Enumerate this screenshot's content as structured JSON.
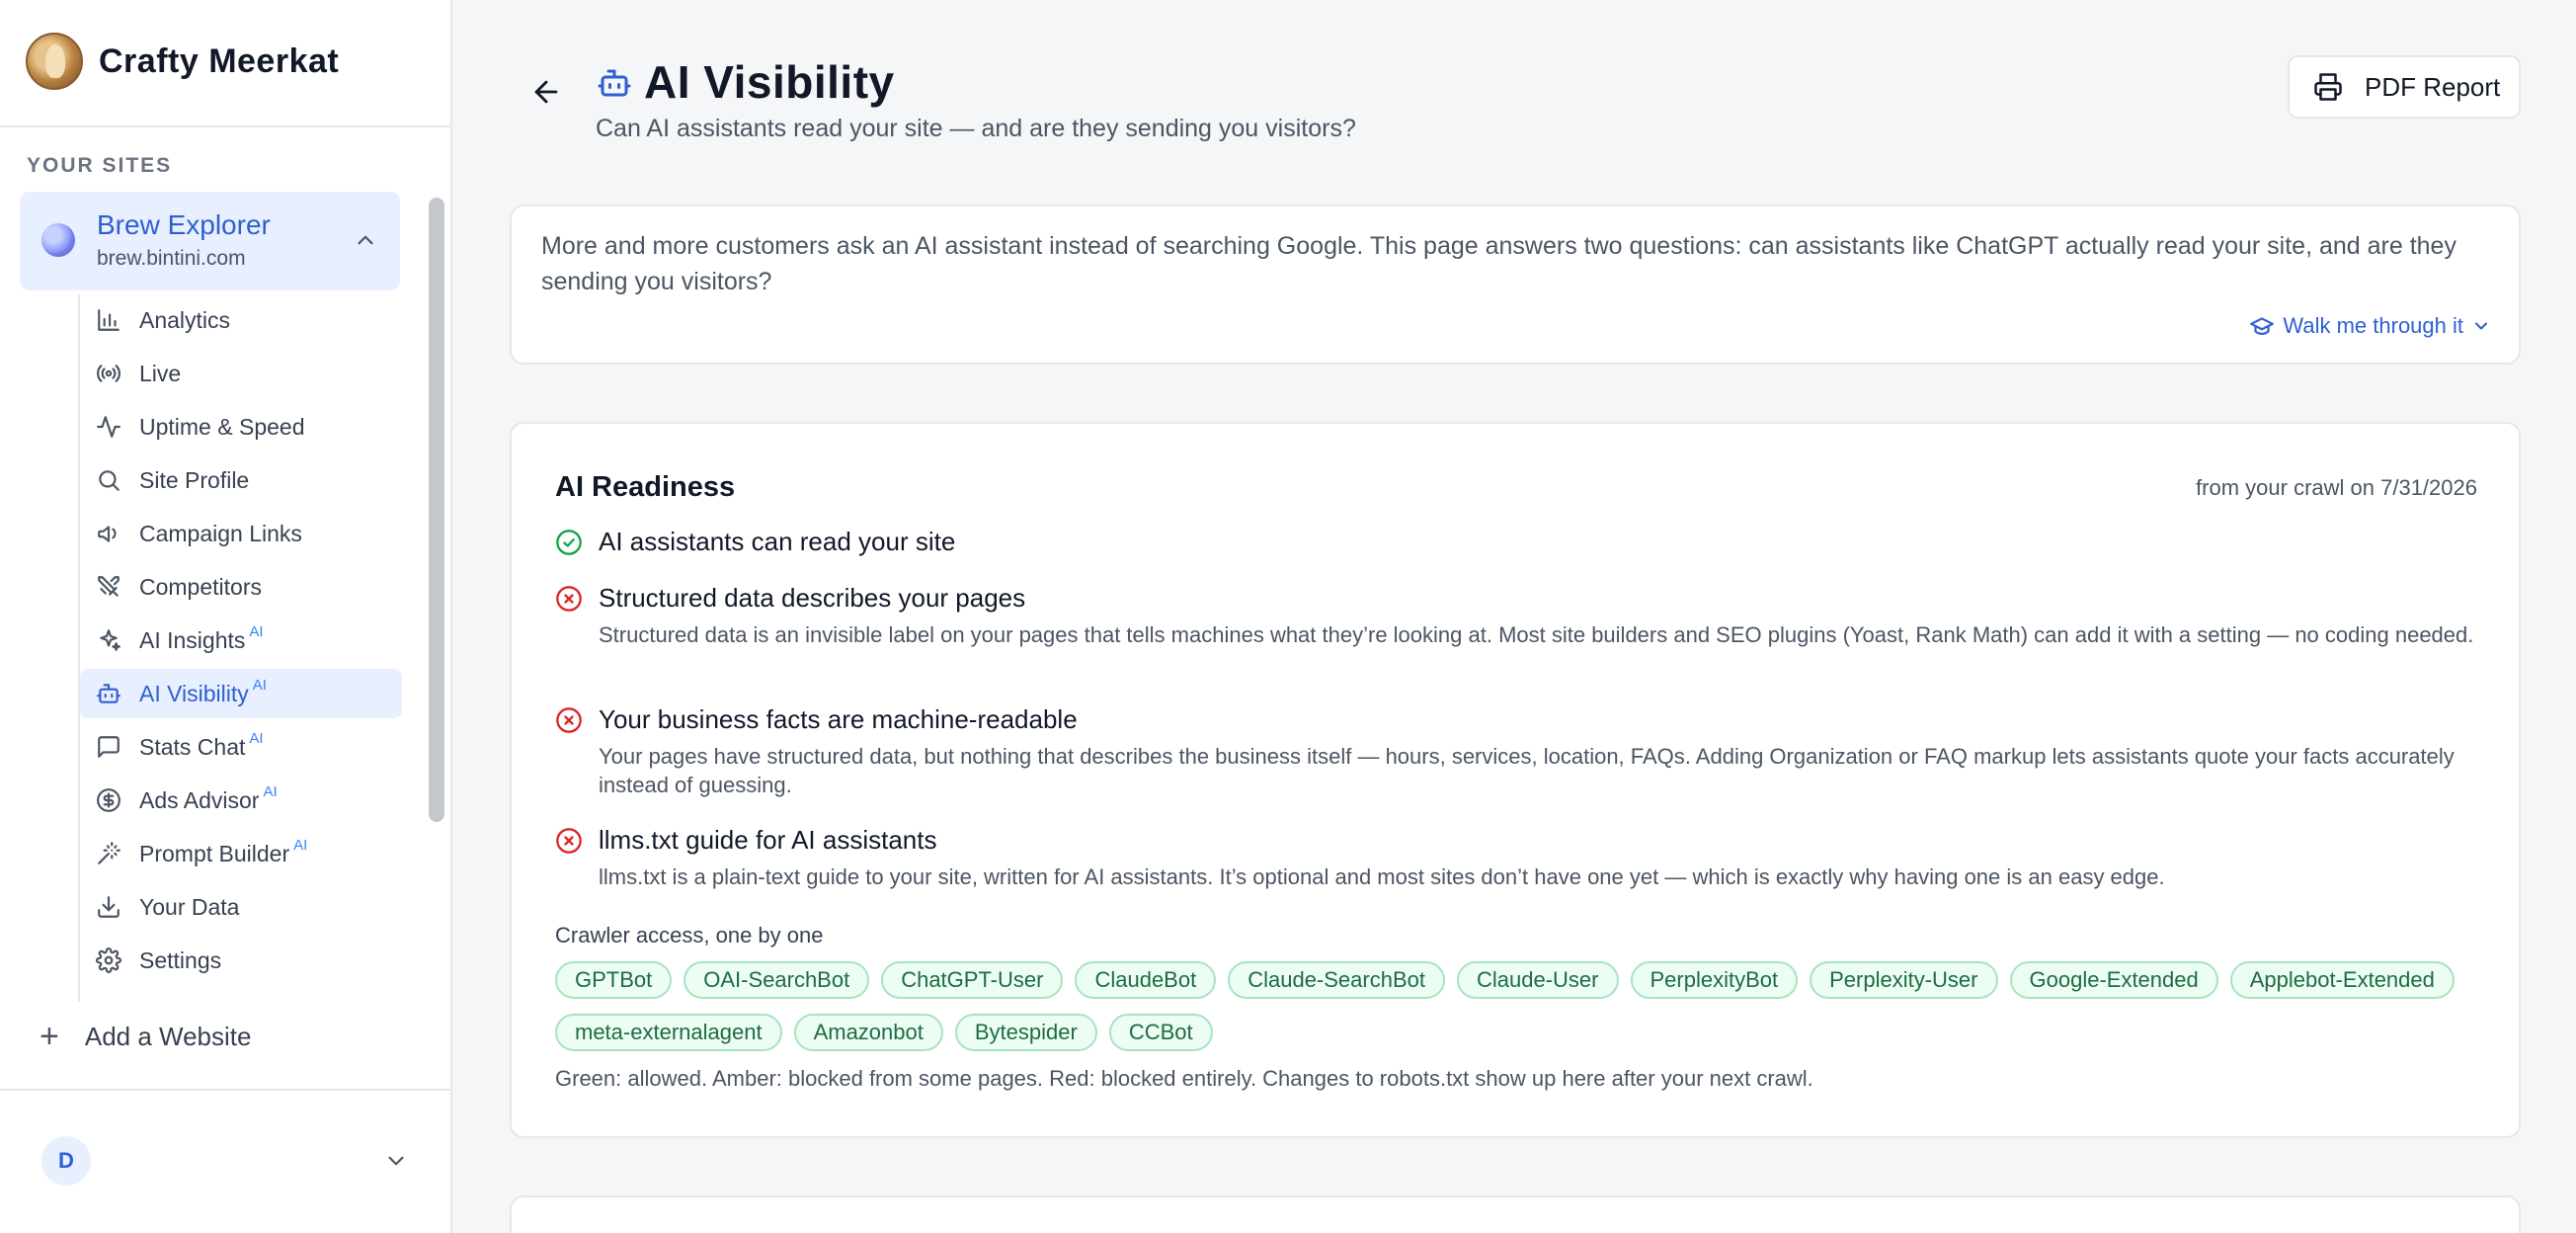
{
  "sidebar": {
    "brand": "Crafty Meerkat",
    "sites_label": "YOUR SITES",
    "site": {
      "name": "Brew Explorer",
      "url": "brew.bintini.com"
    },
    "nav": [
      {
        "label": "Analytics",
        "icon": "bar-chart-icon",
        "ai": ""
      },
      {
        "label": "Live",
        "icon": "broadcast-icon",
        "ai": ""
      },
      {
        "label": "Uptime & Speed",
        "icon": "activity-icon",
        "ai": ""
      },
      {
        "label": "Site Profile",
        "icon": "search-icon",
        "ai": ""
      },
      {
        "label": "Campaign Links",
        "icon": "megaphone-icon",
        "ai": ""
      },
      {
        "label": "Competitors",
        "icon": "swords-icon",
        "ai": ""
      },
      {
        "label": "AI Insights",
        "icon": "sparkles-icon",
        "ai": "AI"
      },
      {
        "label": "AI Visibility",
        "icon": "bot-icon",
        "ai": "AI"
      },
      {
        "label": "Stats Chat",
        "icon": "chat-icon",
        "ai": "AI"
      },
      {
        "label": "Ads Advisor",
        "icon": "dollar-icon",
        "ai": "AI"
      },
      {
        "label": "Prompt Builder",
        "icon": "wand-icon",
        "ai": "AI"
      },
      {
        "label": "Your Data",
        "icon": "download-icon",
        "ai": ""
      },
      {
        "label": "Settings",
        "icon": "gear-icon",
        "ai": ""
      }
    ],
    "active_nav": "AI Visibility",
    "add_site": "Add a Website",
    "user_initial": "D"
  },
  "header": {
    "title": "AI Visibility",
    "subtitle": "Can AI assistants read your site — and are they sending you visitors?",
    "pdf_label": "PDF Report"
  },
  "intro": {
    "text": "More and more customers ask an AI assistant instead of searching Google. This page answers two questions: can assistants like ChatGPT actually read your site, and are they sending you visitors?",
    "walk_label": "Walk me through it"
  },
  "readiness": {
    "title": "AI Readiness",
    "date": "from your crawl on 7/31/2026",
    "checks": [
      {
        "status": "pass",
        "title": "AI assistants can read your site",
        "desc": ""
      },
      {
        "status": "fail",
        "title": "Structured data describes your pages",
        "desc": "Structured data is an invisible label on your pages that tells machines what they’re looking at. Most site builders and SEO plugins (Yoast, Rank Math) can add it with a setting — no coding needed."
      },
      {
        "status": "fail",
        "title": "Your business facts are machine-readable",
        "desc": "Your pages have structured data, but nothing that describes the business itself — hours, services, location, FAQs. Adding Organization or FAQ markup lets assistants quote your facts accurately instead of guessing."
      },
      {
        "status": "fail",
        "title": "llms.txt guide for AI assistants",
        "desc": "llms.txt is a plain-text guide to your site, written for AI assistants. It’s optional and most sites don’t have one yet — which is exactly why having one is an easy edge."
      }
    ],
    "crawler_label": "Crawler access, one by one",
    "crawlers": [
      "GPTBot",
      "OAI-SearchBot",
      "ChatGPT-User",
      "ClaudeBot",
      "Claude-SearchBot",
      "Claude-User",
      "PerplexityBot",
      "Perplexity-User",
      "Google-Extended",
      "Applebot-Extended",
      "meta-externalagent",
      "Amazonbot",
      "Bytespider",
      "CCBot"
    ],
    "crawler_status": "allowed",
    "note": "Green: allowed. Amber: blocked from some pages. Red: blocked entirely. Changes to robots.txt show up here after your next crawl."
  },
  "colors": {
    "accent": "#2f5fd0",
    "active_bg": "#e8efff",
    "pass": "#16a34a",
    "fail": "#dc2626",
    "chip_bg": "#ecfdf3",
    "chip_border": "#a7e3c1"
  }
}
